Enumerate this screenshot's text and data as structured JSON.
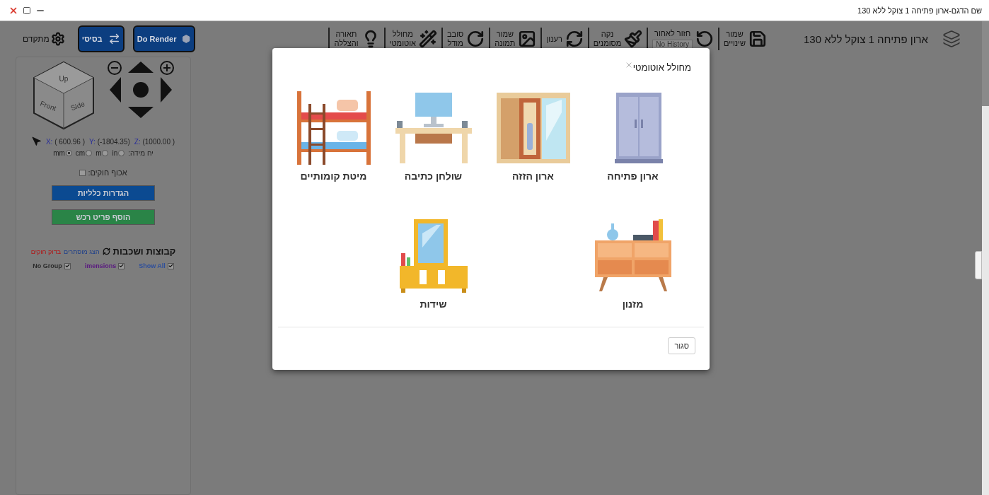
{
  "window": {
    "title": "שם הדגם-ארון פתיחה 1 צוקל ללא 130"
  },
  "toolbar": {
    "model_name": "ארון פתיחה 1 צוקל ללא 130",
    "tools": [
      {
        "kind": "save",
        "label": "שמור\nשינויים"
      },
      {
        "kind": "undo",
        "label": "חזור לאחור",
        "history": "No History"
      },
      {
        "kind": "brush",
        "label": "נקה\nמסומנים"
      },
      {
        "kind": "refresh",
        "label": "רענון"
      },
      {
        "kind": "image",
        "label": "שמור\nתמונה"
      },
      {
        "kind": "rotate",
        "label": "סובב\nמודל"
      },
      {
        "kind": "wand",
        "label": "מחולל\nאוטומטי"
      },
      {
        "kind": "bulb",
        "label": "תאורה\nוהצללה"
      }
    ],
    "buttons": [
      {
        "kind": "render",
        "label": "Do Render"
      },
      {
        "kind": "basic",
        "label": "בסיסי"
      },
      {
        "kind": "advanced",
        "label": "מתקדם"
      }
    ]
  },
  "panel": {
    "view_cube": {
      "up": "Up",
      "front": "Front",
      "side": "Side"
    },
    "coordinates": [
      {
        "axis": "Z:",
        "value": "(1000.00 )"
      },
      {
        "axis": "Y:",
        "value": "(-1804.35)"
      },
      {
        "axis": "X:",
        "value": "( 600.96 )"
      }
    ],
    "units": {
      "label": "יח מידה:",
      "options": [
        {
          "label": "in",
          "selected": false
        },
        {
          "label": "m",
          "selected": false
        },
        {
          "label": "cm",
          "selected": false
        },
        {
          "label": "mm",
          "selected": true
        }
      ]
    },
    "enforce_rules": {
      "label": "אכוף חוקים:",
      "checked": false
    },
    "actions": [
      {
        "kind": "primary",
        "label": "הגדרות כלליות"
      },
      {
        "kind": "success",
        "label": "הוסף פריט רכש"
      }
    ],
    "layers": {
      "title": "קבוצות ושכבות",
      "links": [
        {
          "kind": "info",
          "label": "הצג מוסתרים"
        },
        {
          "kind": "danger",
          "label": "בדוק חוקים"
        }
      ],
      "filters": [
        {
          "label": "Show All",
          "checked": true,
          "color": "#2e4f9c"
        },
        {
          "label": "imensions",
          "checked": true,
          "color": "#5a1a80"
        },
        {
          "label": "No Group",
          "checked": true,
          "color": "#2b2b2b"
        }
      ]
    }
  },
  "modal": {
    "title": "מחולל אוטומטי",
    "items": [
      {
        "kind": "wardrobe",
        "label": "ארון פתיחה"
      },
      {
        "kind": "sliding",
        "label": "ארון הזזה"
      },
      {
        "kind": "desk",
        "label": "שולחן כתיבה"
      },
      {
        "kind": "bunk",
        "label": "מיטת קומותיים"
      },
      {
        "kind": "sideboard",
        "label": "מזנון"
      },
      {
        "kind": "vanity",
        "label": "שידות"
      }
    ],
    "close_label": "סגור"
  }
}
